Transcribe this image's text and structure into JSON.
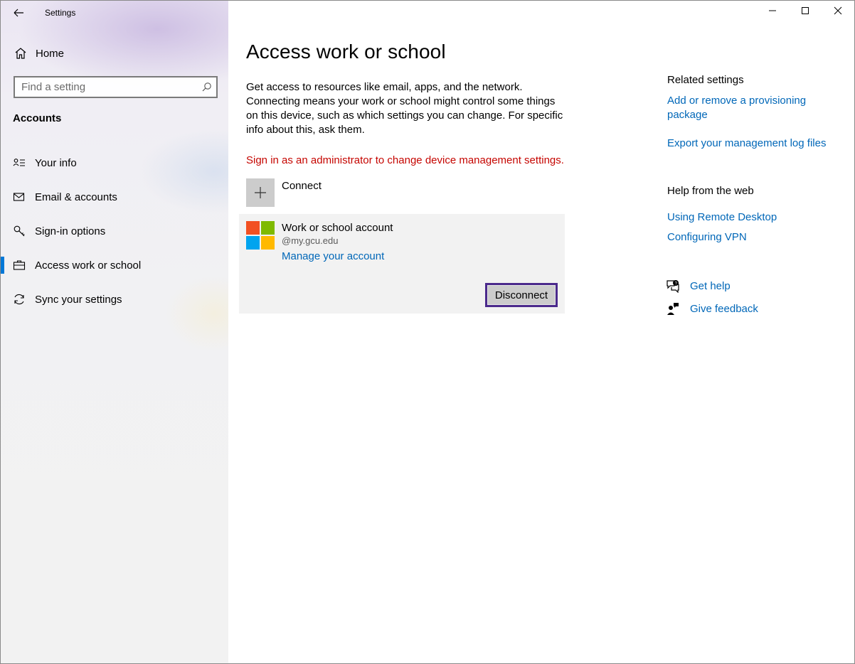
{
  "window": {
    "title": "Settings",
    "controls": {
      "minimize": "minimize-icon",
      "maximize": "maximize-icon",
      "close": "close-icon"
    }
  },
  "sidebar": {
    "home_label": "Home",
    "search": {
      "placeholder": "Find a setting",
      "value": ""
    },
    "section": "Accounts",
    "items": [
      {
        "label": "Your info",
        "icon": "contact-card-icon",
        "selected": false
      },
      {
        "label": "Email & accounts",
        "icon": "mail-icon",
        "selected": false
      },
      {
        "label": "Sign-in options",
        "icon": "key-icon",
        "selected": false
      },
      {
        "label": "Access work or school",
        "icon": "briefcase-icon",
        "selected": true
      },
      {
        "label": "Sync your settings",
        "icon": "sync-icon",
        "selected": false
      }
    ]
  },
  "main": {
    "title": "Access work or school",
    "description": "Get access to resources like email, apps, and the network. Connecting means your work or school might control some things on this device, such as which settings you can change. For specific info about this, ask them.",
    "warning": "Sign in as an administrator to change device management settings.",
    "connect_label": "Connect",
    "account": {
      "name": "Work or school account",
      "email": "@my.gcu.edu",
      "manage_link": "Manage your account",
      "disconnect_label": "Disconnect"
    }
  },
  "related": {
    "title": "Related settings",
    "links": [
      "Add or remove a provisioning package",
      "Export your management log files"
    ]
  },
  "help_web": {
    "title": "Help from the web",
    "links": [
      "Using Remote Desktop",
      "Configuring VPN"
    ]
  },
  "support": {
    "get_help": "Get help",
    "give_feedback": "Give feedback"
  },
  "colors": {
    "accent": "#0078d7",
    "link": "#0067b8",
    "warning": "#c50500",
    "focus_border": "#4b2a8c",
    "ms_red": "#f25022",
    "ms_green": "#7fba00",
    "ms_blue": "#00a4ef",
    "ms_yellow": "#ffb900"
  }
}
